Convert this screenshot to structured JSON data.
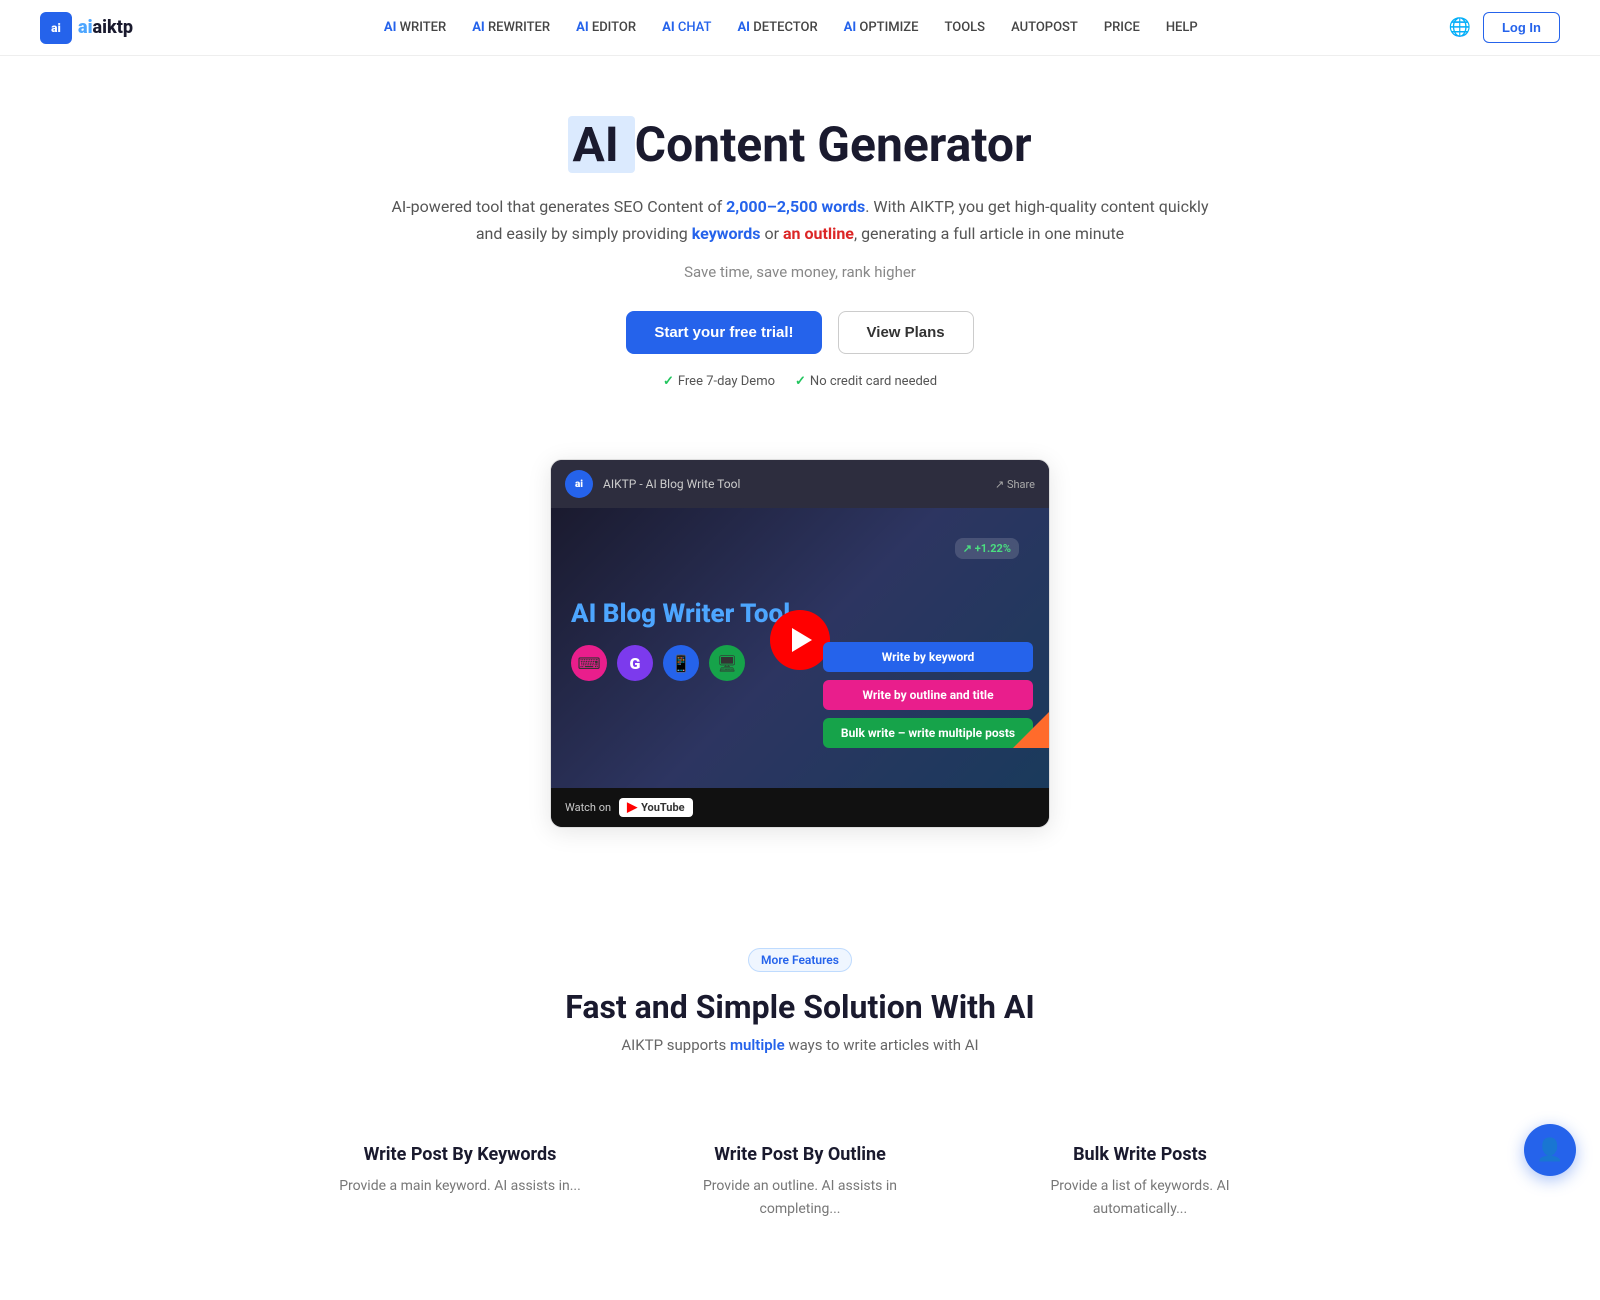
{
  "nav": {
    "logo_text": "aiktp",
    "logo_icon_text": "ai",
    "links": [
      {
        "label": "AI WRITER",
        "ai": "AI",
        "rest": " WRITER",
        "active": false
      },
      {
        "label": "AI REWRITER",
        "ai": "AI",
        "rest": " REWRITER",
        "active": false
      },
      {
        "label": "AI EDITOR",
        "ai": "AI",
        "rest": " EDITOR",
        "active": false
      },
      {
        "label": "AI CHAT",
        "ai": "AI",
        "rest": " CHAT",
        "active": true
      },
      {
        "label": "AI DETECTOR",
        "ai": "AI",
        "rest": " DETECTOR",
        "active": false
      },
      {
        "label": "AI OPTIMIZE",
        "ai": "AI",
        "rest": " OPTIMIZE",
        "active": false
      },
      {
        "label": "TOOLS",
        "ai": "",
        "rest": "TOOLS",
        "active": false
      },
      {
        "label": "AUTOPOST",
        "ai": "",
        "rest": "AUTOPOST",
        "active": false
      },
      {
        "label": "PRICE",
        "ai": "",
        "rest": "PRICE",
        "active": false
      },
      {
        "label": "HELP",
        "ai": "",
        "rest": "HELP",
        "active": false
      }
    ],
    "login_label": "Log In"
  },
  "hero": {
    "title_prefix": "AI ",
    "title_rest": "Content Generator",
    "description": "AI-powered tool that generates SEO Content of ",
    "word_range": "2,000–2,500 words",
    "desc_mid": ". With AIKTP, you get high-quality content quickly and easily by simply providing ",
    "desc_keywords": "keywords",
    "desc_or": " or ",
    "desc_outline": "an outline",
    "desc_end": ", generating a full article in one minute",
    "tagline": "Save time, save money, rank higher",
    "btn_primary": "Start your free trial!",
    "btn_secondary": "View Plans",
    "badge1": "Free 7-day Demo",
    "badge2": "No credit card needed"
  },
  "video": {
    "header_logo": "ai",
    "header_title": "AIKTP - AI Blog Write Tool",
    "header_share": "Share",
    "app_title": "AI Blog Writer Tool",
    "graph_badge": "↗ +1.22%",
    "watch_label": "Watch on",
    "youtube_label": "YouTube",
    "feature_buttons": [
      {
        "label": "Write by keyword",
        "color": "blue"
      },
      {
        "label": "Write by outline and title",
        "color": "pink"
      },
      {
        "label": "Bulk write – write multiple posts",
        "color": "green"
      }
    ],
    "icons": [
      "⌨",
      "G",
      "📱",
      "▶"
    ]
  },
  "more_features": {
    "badge": "More Features",
    "title": "Fast and Simple Solution With AI",
    "subtitle_pre": "AIKTP supports ",
    "subtitle_bold": "multiple",
    "subtitle_post": " ways to write articles with AI"
  },
  "feature_cards": [
    {
      "title": "Write Post By Keywords",
      "desc": "Provide a main keyword. AI assists in..."
    },
    {
      "title": "Write Post By Outline",
      "desc": "Provide an outline. AI assists in completing..."
    },
    {
      "title": "Bulk Write Posts",
      "desc": "Provide a list of keywords. AI automatically..."
    }
  ],
  "floating_chat": {
    "icon": "👤"
  }
}
